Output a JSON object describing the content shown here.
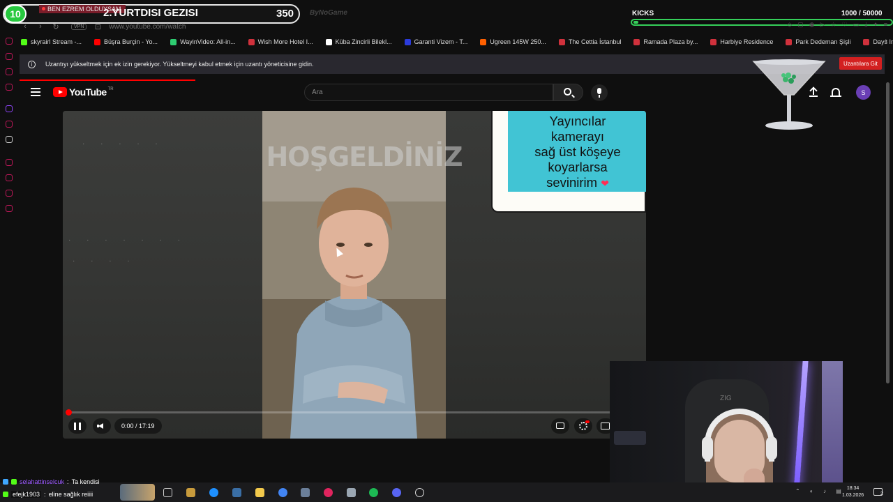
{
  "stream_overlay": {
    "level": "10",
    "tag": "BEN EZREM OLDUYSAM",
    "title": "2.YURTDISI GEZISI",
    "count": "350",
    "brand": "ByNoGame",
    "goal_label": "KICKS",
    "goal_progress": "1000  / 50000",
    "goal_fraction": 0.02,
    "goal_color": "#35d05a"
  },
  "browser": {
    "url": "www.youtube.com/watch",
    "vpn_label": "VPN",
    "bookmarks": [
      {
        "label": "skyrairl Stream -...",
        "icon": "kick-icon",
        "color": "#53fc18"
      },
      {
        "label": "Büşra Burçin - Yo...",
        "icon": "youtube-icon",
        "color": "#ff0000"
      },
      {
        "label": "WayinVideo: All-in...",
        "icon": "wayin-icon",
        "color": "#2ecc71"
      },
      {
        "label": "Wish More Hotel I...",
        "icon": "hotel-icon",
        "color": "#d0313c"
      },
      {
        "label": "Küba Zincirli Bilekl...",
        "icon": "shop-icon",
        "color": "#ffffff"
      },
      {
        "label": "Garanti Vizem - T...",
        "icon": "globe-icon",
        "color": "#2b3bdc"
      },
      {
        "label": "Ugreen 145W 250...",
        "icon": "hb-icon",
        "color": "#ff6000"
      },
      {
        "label": "The Cettia İstanbul",
        "icon": "hotel-icon",
        "color": "#d0313c"
      },
      {
        "label": "Ramada Plaza by...",
        "icon": "hotel-icon",
        "color": "#d0313c"
      },
      {
        "label": "Harbiye Residence",
        "icon": "hotel-icon",
        "color": "#d0313c"
      },
      {
        "label": "Park Dedeman Şişli",
        "icon": "hotel-icon",
        "color": "#d0313c"
      },
      {
        "label": "Days Inn By Wynd...",
        "icon": "hotel-icon",
        "color": "#d0313c"
      }
    ],
    "extension_banner": {
      "text": "Uzantıyı yükseltmek için ek izin gerekiyor. Yükseltmeyi kabul etmek için uzantı yöneticisine gidin.",
      "button": "Uzantılara Git"
    }
  },
  "youtube": {
    "logo_text": "YouTube",
    "region": "TR",
    "search_placeholder": "Ara",
    "avatar_initial": "S",
    "accent": "#ff0000"
  },
  "video": {
    "overlay_text": "HOŞGELDİNİZ",
    "sticker_lines": [
      "Yayıncılar",
      "kamerayı",
      "sağ üst köşeye",
      "koyarlarsa",
      "sevinirim"
    ],
    "current_time": "0:00",
    "duration": "17:19",
    "time_display": "0:00 / 17:19"
  },
  "webcam": {
    "chair_logo": "ZIG"
  },
  "chat": [
    {
      "user": "selahattinselcuk",
      "sep": ":",
      "message": "Ta kendisi"
    },
    {
      "user": "efejk1903",
      "sep": ":",
      "message": "eline sağlık reiiii"
    }
  ],
  "taskbar": {
    "time": "18:34",
    "date": "1.03.2026",
    "notifications": "2"
  }
}
